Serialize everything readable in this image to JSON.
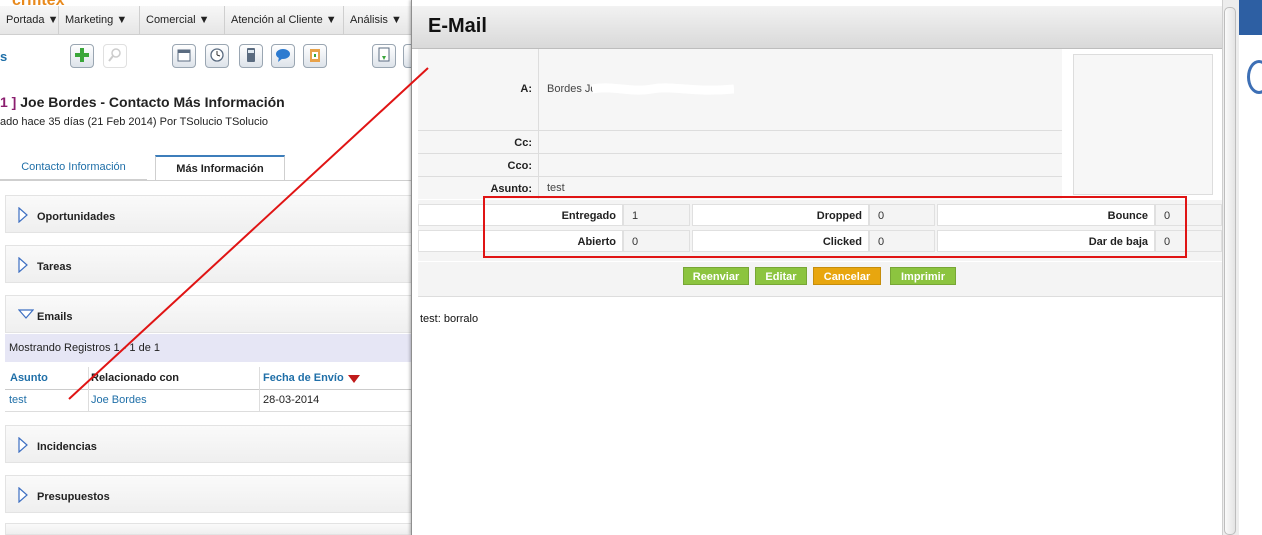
{
  "app": {
    "logo": "crmtex"
  },
  "nav": [
    "Portada ▼",
    "Marketing ▼",
    "Comercial ▼",
    "Atención al Cliente ▼",
    "Análisis ▼"
  ],
  "toolbar": {
    "section_prefix": "s"
  },
  "record": {
    "number": "1 ]",
    "title": "Joe Bordes - Contacto Más Información",
    "subtitle": "ado hace 35 días (21 Feb 2014) Por TSolucio TSolucio"
  },
  "tabs": {
    "contact": "Contacto Información",
    "more": "Más Información"
  },
  "panels": {
    "opportunities": "Oportunidades",
    "tasks": "Tareas",
    "emails": "Emails",
    "incidents": "Incidencias",
    "quotes": "Presupuestos"
  },
  "emails_list": {
    "showing": "Mostrando Registros 1 - 1 de 1",
    "columns": [
      "Asunto",
      "Relacionado con",
      "Fecha de Envío"
    ],
    "rows": [
      {
        "subject": "test",
        "related": "Joe Bordes",
        "date": "28-03-2014"
      }
    ]
  },
  "modal": {
    "title": "E-Mail",
    "fields": {
      "to_label": "A:",
      "to_value": "Bordes Joe<",
      "cc_label": "Cc:",
      "cc_value": "",
      "bcc_label": "Cco:",
      "bcc_value": "",
      "subject_label": "Asunto:",
      "subject_value": "test"
    },
    "stats": {
      "delivered_label": "Entregado",
      "delivered": "1",
      "dropped_label": "Dropped",
      "dropped": "0",
      "bounce_label": "Bounce",
      "bounce": "0",
      "opened_label": "Abierto",
      "opened": "0",
      "clicked_label": "Clicked",
      "clicked": "0",
      "unsub_label": "Dar de baja",
      "unsub": "0"
    },
    "buttons": {
      "resend": "Reenviar",
      "edit": "Editar",
      "cancel": "Cancelar",
      "print": "Imprimir"
    },
    "body": "test: borralo"
  },
  "colors": {
    "green_button": "#8cc43f",
    "cancel_button": "#e8a60f",
    "link": "#1f6fa8",
    "highlight": "#e01414"
  }
}
